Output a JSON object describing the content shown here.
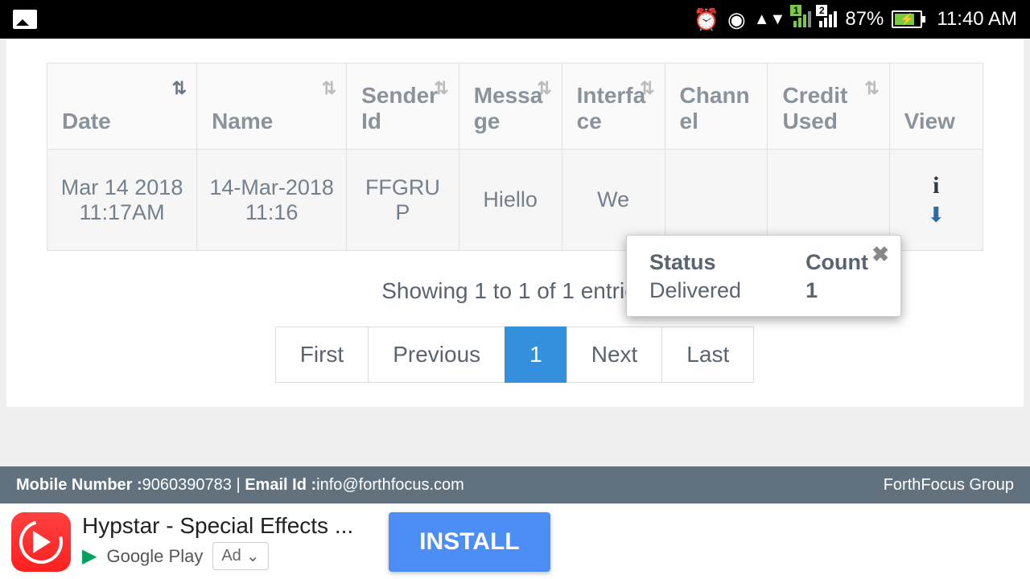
{
  "statusbar": {
    "battery": "87%",
    "time": "11:40 AM",
    "sim1": "1",
    "sim2": "2"
  },
  "table": {
    "headers": [
      "Date",
      "Name",
      "SenderId",
      "Message",
      "Interface",
      "Channel",
      "Credit Used",
      "View"
    ],
    "row": {
      "date": "Mar 14 2018 11:17AM",
      "name": "14-Mar-2018 11:16",
      "sender": "FFGRUP",
      "message": "Hiello",
      "interface": "We"
    }
  },
  "tooltip": {
    "status_label": "Status",
    "status_value": "Delivered",
    "count_label": "Count",
    "count_value": "1"
  },
  "summary": "Showing 1 to 1 of 1 entries",
  "pager": {
    "first": "First",
    "prev": "Previous",
    "page": "1",
    "next": "Next",
    "last": "Last"
  },
  "footer": {
    "mobile_label": "Mobile Number : ",
    "mobile": "9060390783",
    "sep": " | ",
    "email_label": "Email Id : ",
    "email": "info@forthfocus.com",
    "brand": "ForthFocus Group"
  },
  "ad": {
    "title": "Hypstar - Special Effects ...",
    "store": "Google Play",
    "badge": "Ad",
    "install": "INSTALL"
  }
}
